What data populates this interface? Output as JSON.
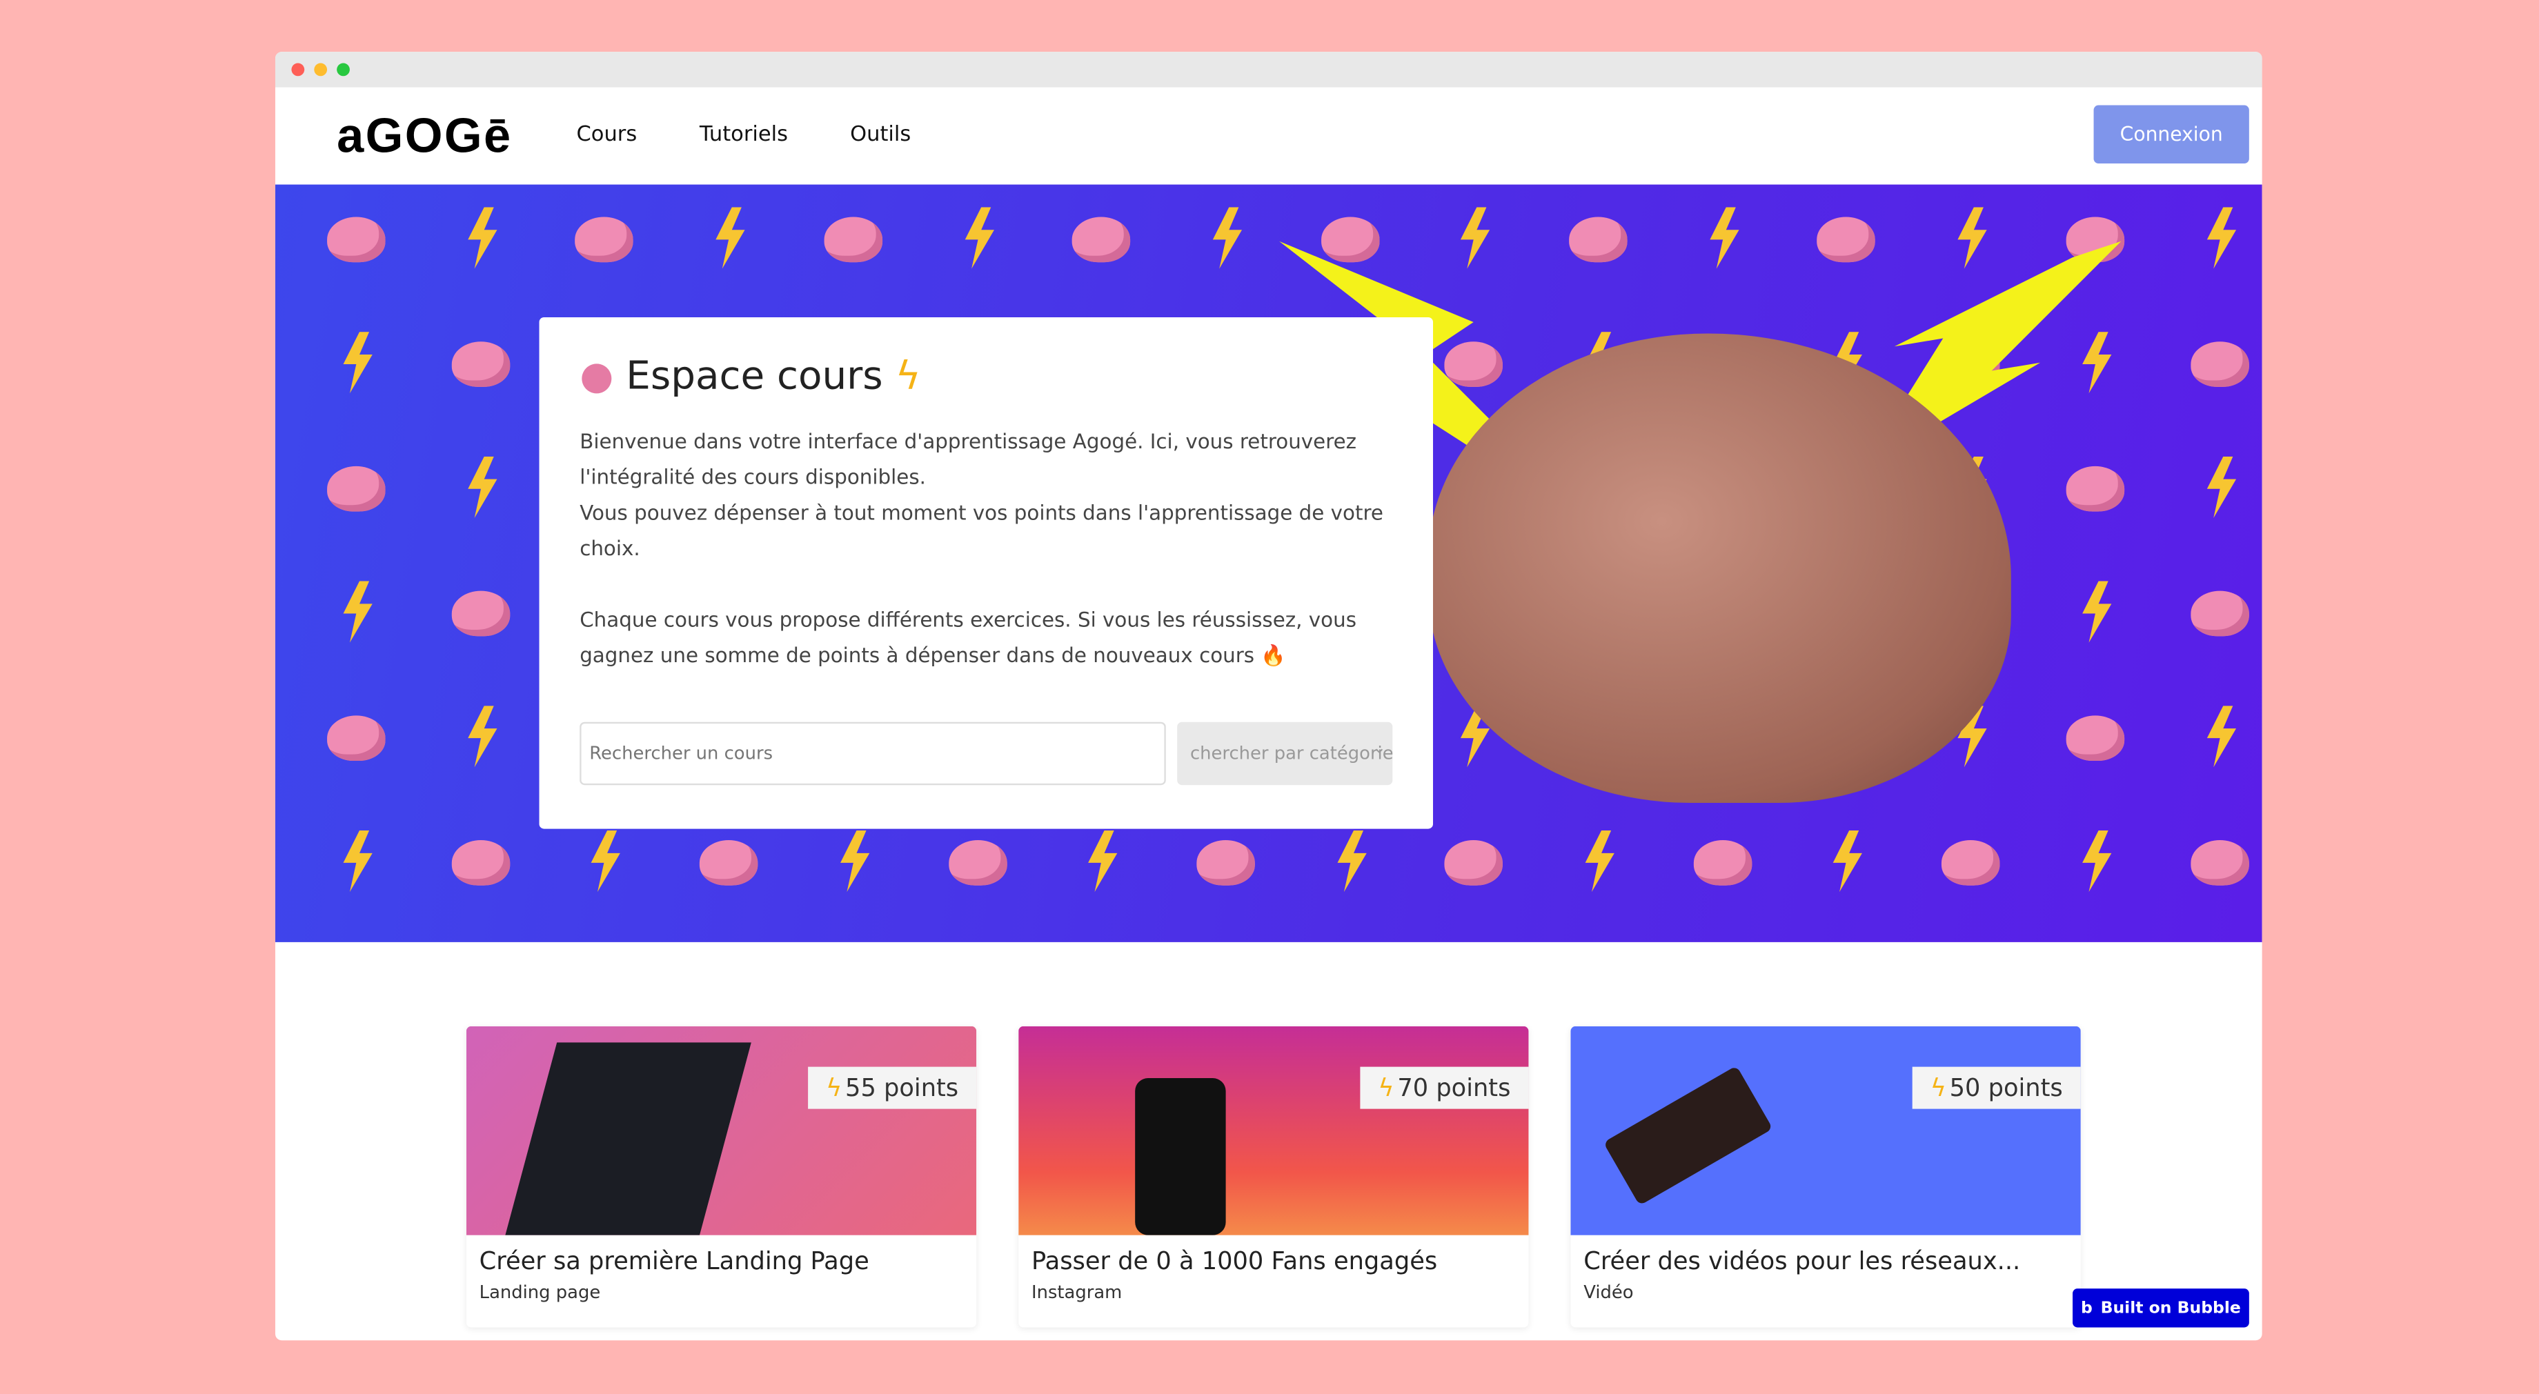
{
  "window": {
    "dots": [
      "#fe5f57",
      "#febc2e",
      "#28c840"
    ]
  },
  "nav": {
    "logo": "aGOGē",
    "links": [
      "Cours",
      "Tutoriels",
      "Outils"
    ],
    "login": "Connexion"
  },
  "hero": {
    "title": "Espace cours",
    "paragraph1a": "Bienvenue dans votre interface d'apprentissage Agogé. Ici, vous retrouverez l'intégralité des cours disponibles.",
    "paragraph1b": "Vous pouvez dépenser à tout moment vos points dans l'apprentissage de votre choix.",
    "paragraph2": "Chaque cours vous propose différents exercices. Si vous les réussissez, vous gagnez une somme de points à dépenser dans de nouveaux cours 🔥",
    "search_placeholder": "Rechercher un cours",
    "category_placeholder": "chercher par catégorie"
  },
  "courses": [
    {
      "points": "55 points",
      "title": "Créer sa première Landing Page",
      "category": "Landing page"
    },
    {
      "points": "70 points",
      "title": "Passer de 0 à 1000 Fans engagés",
      "category": "Instagram"
    },
    {
      "points": "50 points",
      "title": "Créer des vidéos pour les réseaux...",
      "category": "Vidéo"
    }
  ],
  "bubble": {
    "label": "Built on Bubble",
    "color": "#0000d9"
  },
  "colors": {
    "background": "#ffb5b3",
    "accent": "#7f95eb",
    "hero": "#4a35e8"
  }
}
